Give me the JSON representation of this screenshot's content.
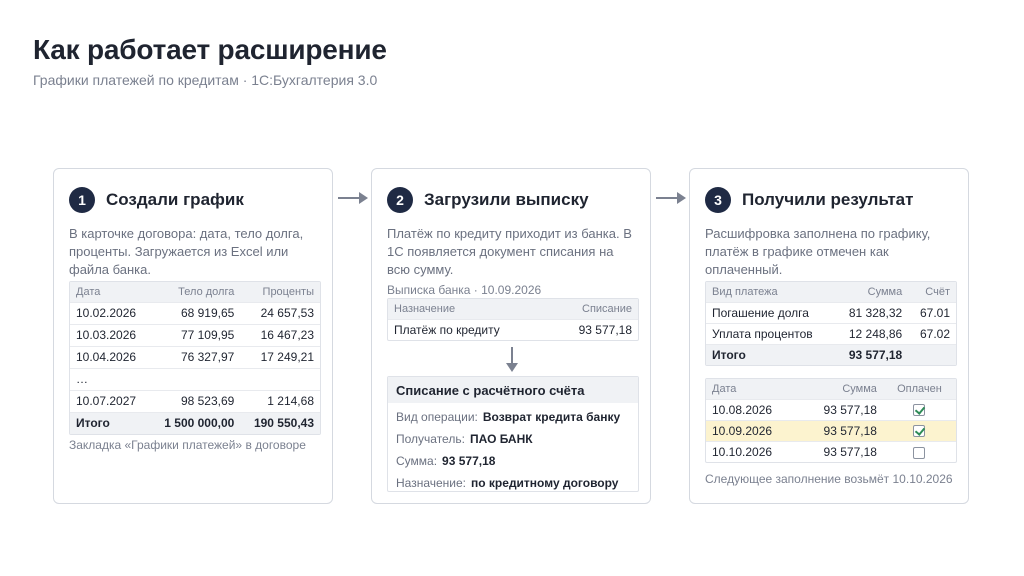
{
  "header": {
    "title": "Как работает расширение",
    "subtitle": "Графики платежей по кредитам · 1С:Бухгалтерия 3.0"
  },
  "colors": {
    "accent": "#1f2a44",
    "highlight_row": "#fcf3cf",
    "check": "#2e8b57",
    "border": "#d5d9e0"
  },
  "icons": {
    "flow_arrow": "arrow-right-icon",
    "down_arrow": "arrow-down-icon",
    "checkbox": "checkbox-icon"
  },
  "steps": [
    {
      "number": "1",
      "title": "Создали график",
      "description": "В карточке договора: дата, тело долга, проценты. Загружается из Excel или файла банка.",
      "schedule": {
        "headers": [
          "Дата",
          "Тело долга",
          "Проценты"
        ],
        "rows": [
          [
            "10.02.2026",
            "68 919,65",
            "24 657,53"
          ],
          [
            "10.03.2026",
            "77 109,95",
            "16 467,23"
          ],
          [
            "10.04.2026",
            "76 327,97",
            "17 249,21"
          ],
          [
            "…",
            "",
            ""
          ],
          [
            "10.07.2027",
            "98 523,69",
            "1 214,68"
          ]
        ],
        "total": [
          "Итого",
          "1 500 000,00",
          "190 550,43"
        ]
      },
      "note": "Закладка «Графики платежей» в договоре"
    },
    {
      "number": "2",
      "title": "Загрузили выписку",
      "description": "Платёж по кредиту приходит из банка. В 1С появляется документ списания на всю сумму.",
      "bank_caption": "Выписка банка · 10.09.2026",
      "bank": {
        "headers": [
          "Назначение",
          "Списание"
        ],
        "rows": [
          [
            "Платёж по кредиту",
            "93 577,18"
          ]
        ]
      },
      "document": {
        "title": "Списание с расчётного счёта",
        "fields": [
          {
            "label": "Вид операции:",
            "value": "Возврат кредита банку"
          },
          {
            "label": "Получатель:",
            "value": "ПАО БАНК"
          },
          {
            "label": "Сумма:",
            "value": "93 577,18"
          },
          {
            "label": "Назначение:",
            "value": "по кредитному договору"
          }
        ]
      }
    },
    {
      "number": "3",
      "title": "Получили результат",
      "description": "Расшифровка заполнена по графику, платёж в графике отмечен как оплаченный.",
      "breakdown": {
        "headers": [
          "Вид платежа",
          "Сумма",
          "Счёт"
        ],
        "rows": [
          [
            "Погашение долга",
            "81 328,32",
            "67.01"
          ],
          [
            "Уплата процентов",
            "12 248,86",
            "67.02"
          ]
        ],
        "total": [
          "Итого",
          "93 577,18",
          ""
        ]
      },
      "payments": {
        "headers": [
          "Дата",
          "Сумма",
          "Оплачен"
        ],
        "rows": [
          {
            "date": "10.08.2026",
            "sum": "93 577,18",
            "paid": true,
            "highlight": false
          },
          {
            "date": "10.09.2026",
            "sum": "93 577,18",
            "paid": true,
            "highlight": true
          },
          {
            "date": "10.10.2026",
            "sum": "93 577,18",
            "paid": false,
            "highlight": false
          }
        ]
      },
      "note": "Следующее заполнение возьмёт 10.10.2026"
    }
  ]
}
